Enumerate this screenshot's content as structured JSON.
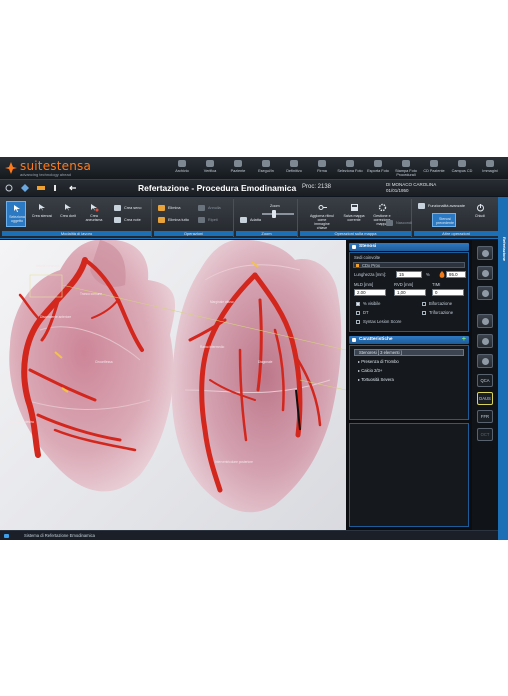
{
  "brand": {
    "name": "suitestensa",
    "tagline": "advancing technology ahead"
  },
  "nav": {
    "items": [
      "Archivio",
      "Verifica",
      "Paziente",
      "Esegui/In",
      "Definitivo",
      "Firma",
      "Seleziona Foto",
      "Esporta Foto",
      "Stampa Foto Procedurali",
      "CD Paziente",
      "Campus CD",
      "Immagini"
    ]
  },
  "titlebar": {
    "title": "Refertazione - Procedura Emodinamica",
    "procedure": "Proc: 2138",
    "patient_name": "DI MONACO CAROLINA",
    "patient_dob": "01/01/1950"
  },
  "ribbon": {
    "groups": [
      {
        "label": "Modalità di lavoro",
        "buttons": [
          "Seleziona oggetto",
          "Crea stenosi",
          "Crea dorit",
          "Crea aneurisma"
        ],
        "small": [
          "Crea seno",
          "Crea note"
        ]
      },
      {
        "label": "Operazioni",
        "small": [
          "Elimina",
          "Elimina tutto",
          "Annulla",
          "Ripeti"
        ]
      },
      {
        "label": "Zoom",
        "small": [
          "Adatta",
          "Zoom"
        ]
      },
      {
        "label": "Operazioni sulla mappa",
        "buttons": [
          "Aggiorna ritinul come immagine chiave",
          "Salva mappa corrente",
          "Gestione e correzione mappa",
          "Nascondi"
        ]
      },
      {
        "label": "Altre operazioni",
        "buttons": [
          "Funzionalità avanzate",
          "Stenosi precedente",
          "Chiudi"
        ]
      }
    ],
    "side_label": "Refertazione"
  },
  "viewport": {
    "annotations": [
      "Arteria coronaria",
      "Tronco comune",
      "Discendente anteriore",
      "Circonflessa",
      "Coronaria destra",
      "Marginale ottuso",
      "Ramo intermedio",
      "Diagonale",
      "Interventricolare posteriore"
    ]
  },
  "panel": {
    "stenosis": {
      "header": "Stenosi",
      "sub": "Sedi coinvolte",
      "row_label": "CDx Prox",
      "length_label": "Lunghezza [mm]:",
      "length_value": "15",
      "pct_symbol": "%",
      "pct_value": "95.0",
      "mld_label": "MLD [mm]",
      "rvd_label": "RVD [mm]",
      "timi_label": "TIMI",
      "mld_value": "2.00",
      "rvd_value": "1,00",
      "timi_value": "0",
      "checks": [
        {
          "label": "% visibile",
          "on": true
        },
        {
          "label": "Biforcazione",
          "on": false
        },
        {
          "label": "DT",
          "on": false
        },
        {
          "label": "Triforcazione",
          "on": false
        },
        {
          "label": "Syntax Lesion Score",
          "on": false
        }
      ]
    },
    "features": {
      "header": "Caratteristiche",
      "root": "Stenoresi [ 3 elementi ]",
      "items": [
        "Presenza di Trombo",
        "Calcio 2/3+",
        "Tortuosità Severa"
      ]
    }
  },
  "tools": {
    "labels": [
      "QCA",
      "DAUS",
      "FFR",
      "OCT"
    ]
  },
  "statusbar": {
    "text": "Sistema di Refertazione Emodinamica"
  },
  "colors": {
    "accent": "#1d6fb5",
    "vessel": "#d3261c",
    "brand": "#ff7a1a"
  }
}
